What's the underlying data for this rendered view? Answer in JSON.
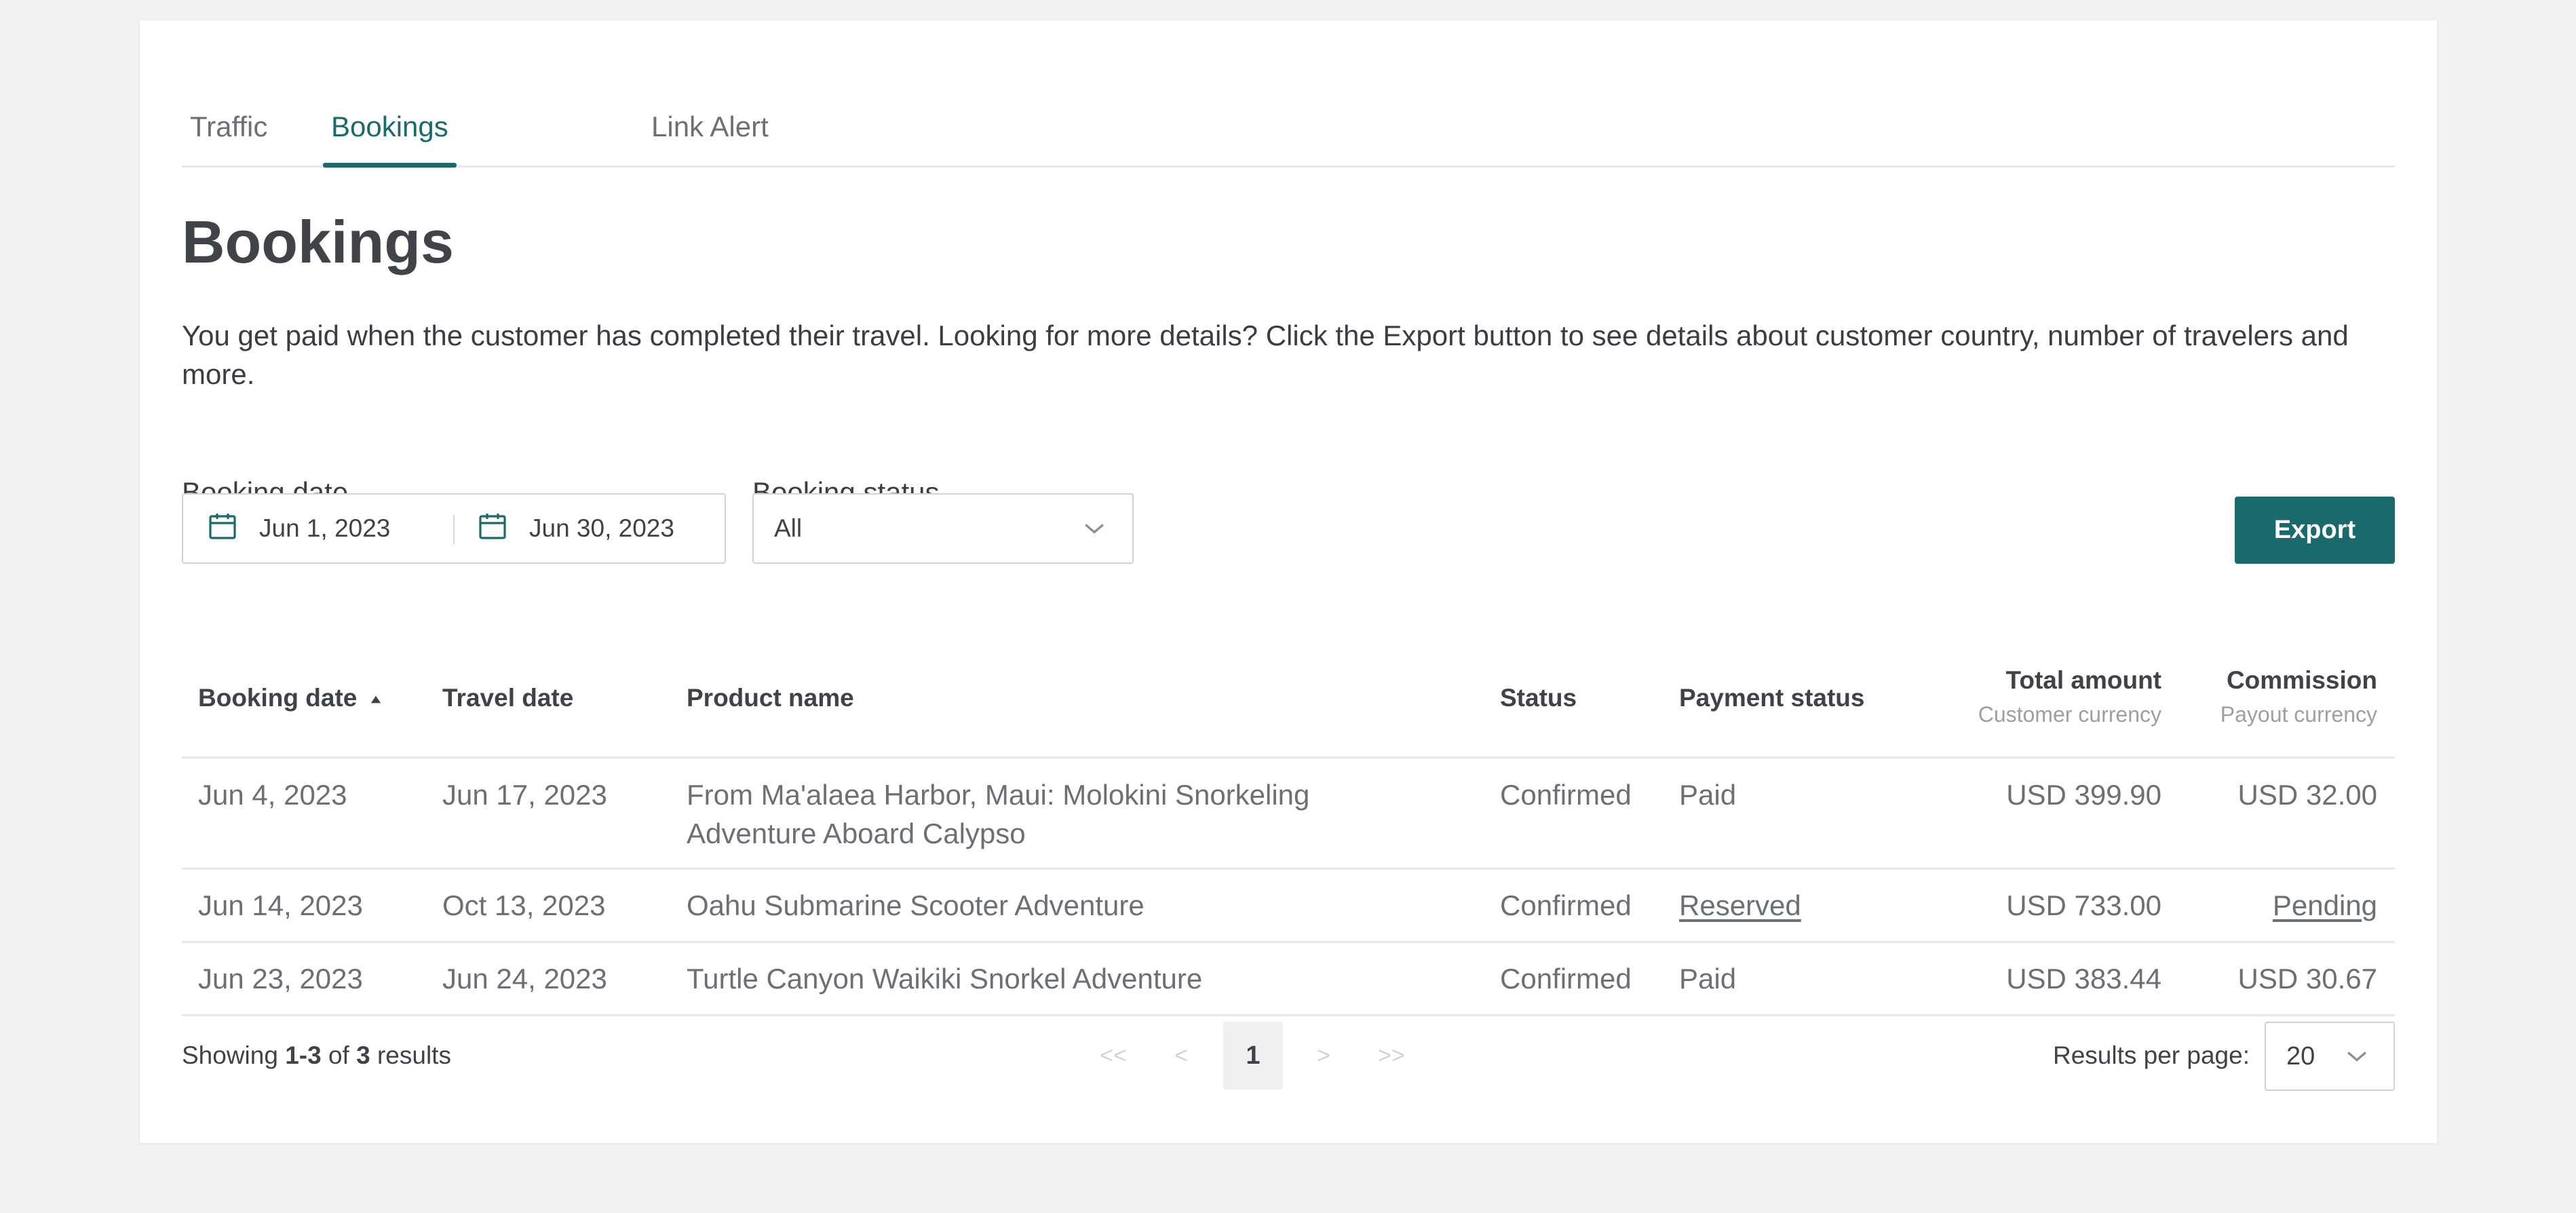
{
  "tabs": [
    {
      "label": "Traffic"
    },
    {
      "label": "Bookings"
    },
    {
      "label": "Link Alert"
    }
  ],
  "page": {
    "title": "Bookings",
    "description": "You get paid when the customer has completed their travel. Looking for more details? Click the Export button to see details about customer country, number of travelers and more."
  },
  "filters": {
    "booking_date_label": "Booking date",
    "date_from": "Jun 1, 2023",
    "date_to": "Jun 30, 2023",
    "booking_status_label": "Booking status",
    "booking_status_value": "All"
  },
  "export_label": "Export",
  "table": {
    "headers": {
      "booking_date": "Booking date",
      "travel_date": "Travel date",
      "product_name": "Product name",
      "status": "Status",
      "payment_status": "Payment status",
      "total_amount": "Total amount",
      "total_amount_sub": "Customer currency",
      "commission": "Commission",
      "commission_sub": "Payout currency"
    },
    "rows": [
      {
        "booking_date": "Jun 4, 2023",
        "travel_date": "Jun 17, 2023",
        "product_name": "From Ma'alaea Harbor, Maui: Molokini Snorkeling Adventure Aboard Calypso",
        "status": "Confirmed",
        "payment_status": "Paid",
        "total_amount": "USD 399.90",
        "commission": "USD 32.00"
      },
      {
        "booking_date": "Jun 14, 2023",
        "travel_date": "Oct 13, 2023",
        "product_name": "Oahu Submarine Scooter Adventure",
        "status": "Confirmed",
        "payment_status": "Reserved",
        "total_amount": "USD 733.00",
        "commission": "Pending"
      },
      {
        "booking_date": "Jun 23, 2023",
        "travel_date": "Jun 24, 2023",
        "product_name": "Turtle Canyon Waikiki Snorkel Adventure",
        "status": "Confirmed",
        "payment_status": "Paid",
        "total_amount": "USD 383.44",
        "commission": "USD 30.67"
      }
    ]
  },
  "footer": {
    "showing_prefix": "Showing",
    "showing_range": "1-3",
    "showing_of": "of",
    "showing_total": "3",
    "showing_suffix": "results",
    "pager": {
      "first": "<<",
      "prev": "<",
      "current": "1",
      "next": ">",
      "last": ">>"
    },
    "results_per_page_label": "Results per page:",
    "results_per_page_value": "20"
  },
  "colors": {
    "accent": "#1a6a6c",
    "page_bg": "#f2f2f2"
  },
  "icons": {
    "calendar": "calendar-icon",
    "chevron": "chevron-down-icon",
    "sort": "sort-asc-icon"
  }
}
